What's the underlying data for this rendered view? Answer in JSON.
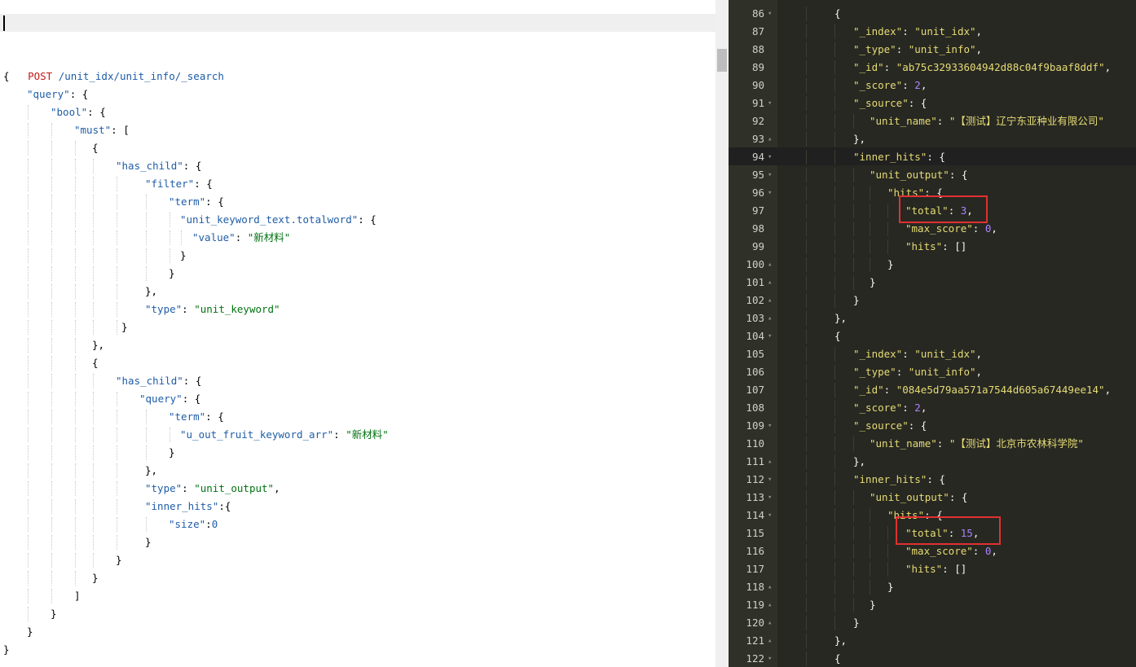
{
  "request": {
    "method": "POST",
    "url": " /unit_idx/unit_info/_search",
    "lines": [
      [
        [
          "p",
          "{"
        ]
      ],
      [
        [
          "k",
          "\"query\""
        ],
        [
          "p",
          ": {"
        ]
      ],
      [
        [
          "k",
          "\"bool\""
        ],
        [
          "p",
          ": {"
        ]
      ],
      [
        [
          "k",
          "\"must\""
        ],
        [
          "p",
          ": ["
        ]
      ],
      [
        [
          "p",
          "{"
        ]
      ],
      [
        [
          "k",
          "\"has_child\""
        ],
        [
          "p",
          ": {"
        ]
      ],
      [
        [
          "k",
          "\"filter\""
        ],
        [
          "p",
          ": {"
        ]
      ],
      [
        [
          "k",
          "\"term\""
        ],
        [
          "p",
          ": {"
        ]
      ],
      [
        [
          "k",
          "\"unit_keyword_text.totalword\""
        ],
        [
          "p",
          ": {"
        ]
      ],
      [
        [
          "k",
          "\"value\""
        ],
        [
          "p",
          ": "
        ],
        [
          "s",
          "\"新材料\""
        ]
      ],
      [
        [
          "p",
          "}"
        ]
      ],
      [
        [
          "p",
          "}"
        ]
      ],
      [
        [
          "p",
          "},"
        ]
      ],
      [
        [
          "k",
          "\"type\""
        ],
        [
          "p",
          ": "
        ],
        [
          "s",
          "\"unit_keyword\""
        ]
      ],
      [
        [
          "p",
          "}"
        ]
      ],
      [
        [
          "p",
          "},"
        ]
      ],
      [
        [
          "p",
          "{"
        ]
      ],
      [
        [
          "k",
          "\"has_child\""
        ],
        [
          "p",
          ": {"
        ]
      ],
      [
        [
          "k",
          "\"query\""
        ],
        [
          "p",
          ": {"
        ]
      ],
      [
        [
          "k",
          "\"term\""
        ],
        [
          "p",
          ": {"
        ]
      ],
      [
        [
          "k",
          "\"u_out_fruit_keyword_arr\""
        ],
        [
          "p",
          ": "
        ],
        [
          "s",
          "\"新材料\""
        ]
      ],
      [
        [
          "p",
          "}"
        ]
      ],
      [
        [
          "p",
          "},"
        ]
      ],
      [
        [
          "k",
          "\"type\""
        ],
        [
          "p",
          ": "
        ],
        [
          "s",
          "\"unit_output\""
        ],
        [
          "p",
          ","
        ]
      ],
      [
        [
          "k",
          "\"inner_hits\""
        ],
        [
          "p",
          ":{"
        ]
      ],
      [
        [
          "k",
          "\"size\""
        ],
        [
          "p",
          ":"
        ],
        [
          "n",
          "0"
        ]
      ],
      [
        [
          "p",
          "}"
        ]
      ],
      [
        [
          "p",
          "}"
        ]
      ],
      [
        [
          "p",
          "}"
        ]
      ],
      [
        [
          "p",
          "]"
        ]
      ],
      [
        [
          "p",
          "}"
        ]
      ],
      [
        [
          "p",
          "}"
        ]
      ],
      [
        [
          "p",
          "}"
        ]
      ]
    ]
  },
  "response": {
    "lines": [
      {
        "n": "86",
        "fold": "▾",
        "t": [
          [
            "w",
            "{"
          ]
        ]
      },
      {
        "n": "87",
        "fold": "",
        "t": [
          [
            "rk",
            "\"_index\""
          ],
          [
            "w",
            ": "
          ],
          [
            "rs",
            "\"unit_idx\""
          ],
          [
            "w",
            ","
          ]
        ]
      },
      {
        "n": "88",
        "fold": "",
        "t": [
          [
            "rk",
            "\"_type\""
          ],
          [
            "w",
            ": "
          ],
          [
            "rs",
            "\"unit_info\""
          ],
          [
            "w",
            ","
          ]
        ]
      },
      {
        "n": "89",
        "fold": "",
        "t": [
          [
            "rk",
            "\"_id\""
          ],
          [
            "w",
            ": "
          ],
          [
            "rs",
            "\"ab75c32933604942d88c04f9baaf8ddf\""
          ],
          [
            "w",
            ","
          ]
        ]
      },
      {
        "n": "90",
        "fold": "",
        "t": [
          [
            "rk",
            "\"_score\""
          ],
          [
            "w",
            ": "
          ],
          [
            "rn",
            "2"
          ],
          [
            "w",
            ","
          ]
        ]
      },
      {
        "n": "91",
        "fold": "▾",
        "t": [
          [
            "rk",
            "\"_source\""
          ],
          [
            "w",
            ": {"
          ]
        ]
      },
      {
        "n": "92",
        "fold": "",
        "t": [
          [
            "rk",
            "\"unit_name\""
          ],
          [
            "w",
            ": "
          ],
          [
            "rs",
            "\"【测试】辽宁东亚种业有限公司\""
          ]
        ]
      },
      {
        "n": "93",
        "fold": "▴",
        "t": [
          [
            "w",
            "},"
          ]
        ]
      },
      {
        "n": "94",
        "fold": "▾",
        "t": [
          [
            "rk",
            "\"inner_hits\""
          ],
          [
            "w",
            ": {"
          ]
        ]
      },
      {
        "n": "95",
        "fold": "▾",
        "t": [
          [
            "rk",
            "\"unit_output\""
          ],
          [
            "w",
            ": {"
          ]
        ]
      },
      {
        "n": "96",
        "fold": "▾",
        "t": [
          [
            "rk",
            "\"hits\""
          ],
          [
            "w",
            ": {"
          ]
        ]
      },
      {
        "n": "97",
        "fold": "",
        "t": [
          [
            "rk",
            "\"total\""
          ],
          [
            "w",
            ": "
          ],
          [
            "rn",
            "3"
          ],
          [
            "w",
            ","
          ]
        ]
      },
      {
        "n": "98",
        "fold": "",
        "t": [
          [
            "rk",
            "\"max_score\""
          ],
          [
            "w",
            ": "
          ],
          [
            "rn",
            "0"
          ],
          [
            "w",
            ","
          ]
        ]
      },
      {
        "n": "99",
        "fold": "",
        "t": [
          [
            "rk",
            "\"hits\""
          ],
          [
            "w",
            ": []"
          ]
        ]
      },
      {
        "n": "100",
        "fold": "▴",
        "t": [
          [
            "w",
            "}"
          ]
        ]
      },
      {
        "n": "101",
        "fold": "▴",
        "t": [
          [
            "w",
            "}"
          ]
        ]
      },
      {
        "n": "102",
        "fold": "▴",
        "t": [
          [
            "w",
            "}"
          ]
        ]
      },
      {
        "n": "103",
        "fold": "▴",
        "t": [
          [
            "w",
            "},"
          ]
        ]
      },
      {
        "n": "104",
        "fold": "▾",
        "t": [
          [
            "w",
            "{"
          ]
        ]
      },
      {
        "n": "105",
        "fold": "",
        "t": [
          [
            "rk",
            "\"_index\""
          ],
          [
            "w",
            ": "
          ],
          [
            "rs",
            "\"unit_idx\""
          ],
          [
            "w",
            ","
          ]
        ]
      },
      {
        "n": "106",
        "fold": "",
        "t": [
          [
            "rk",
            "\"_type\""
          ],
          [
            "w",
            ": "
          ],
          [
            "rs",
            "\"unit_info\""
          ],
          [
            "w",
            ","
          ]
        ]
      },
      {
        "n": "107",
        "fold": "",
        "t": [
          [
            "rk",
            "\"_id\""
          ],
          [
            "w",
            ": "
          ],
          [
            "rs",
            "\"084e5d79aa571a7544d605a67449ee14\""
          ],
          [
            "w",
            ","
          ]
        ]
      },
      {
        "n": "108",
        "fold": "",
        "t": [
          [
            "rk",
            "\"_score\""
          ],
          [
            "w",
            ": "
          ],
          [
            "rn",
            "2"
          ],
          [
            "w",
            ","
          ]
        ]
      },
      {
        "n": "109",
        "fold": "▾",
        "t": [
          [
            "rk",
            "\"_source\""
          ],
          [
            "w",
            ": {"
          ]
        ]
      },
      {
        "n": "110",
        "fold": "",
        "t": [
          [
            "rk",
            "\"unit_name\""
          ],
          [
            "w",
            ": "
          ],
          [
            "rs",
            "\"【测试】北京市农林科学院\""
          ]
        ]
      },
      {
        "n": "111",
        "fold": "▴",
        "t": [
          [
            "w",
            "},"
          ]
        ]
      },
      {
        "n": "112",
        "fold": "▾",
        "t": [
          [
            "rk",
            "\"inner_hits\""
          ],
          [
            "w",
            ": {"
          ]
        ]
      },
      {
        "n": "113",
        "fold": "▾",
        "t": [
          [
            "rk",
            "\"unit_output\""
          ],
          [
            "w",
            ": {"
          ]
        ]
      },
      {
        "n": "114",
        "fold": "▾",
        "t": [
          [
            "rk",
            "\"hits\""
          ],
          [
            "w",
            ": {"
          ]
        ]
      },
      {
        "n": "115",
        "fold": "",
        "t": [
          [
            "rk",
            "\"total\""
          ],
          [
            "w",
            ": "
          ],
          [
            "rn",
            "15"
          ],
          [
            "w",
            ","
          ]
        ]
      },
      {
        "n": "116",
        "fold": "",
        "t": [
          [
            "rk",
            "\"max_score\""
          ],
          [
            "w",
            ": "
          ],
          [
            "rn",
            "0"
          ],
          [
            "w",
            ","
          ]
        ]
      },
      {
        "n": "117",
        "fold": "",
        "t": [
          [
            "rk",
            "\"hits\""
          ],
          [
            "w",
            ": []"
          ]
        ]
      },
      {
        "n": "118",
        "fold": "▴",
        "t": [
          [
            "w",
            "}"
          ]
        ]
      },
      {
        "n": "119",
        "fold": "▴",
        "t": [
          [
            "w",
            "}"
          ]
        ]
      },
      {
        "n": "120",
        "fold": "▴",
        "t": [
          [
            "w",
            "}"
          ]
        ]
      },
      {
        "n": "121",
        "fold": "▴",
        "t": [
          [
            "w",
            "},"
          ]
        ]
      },
      {
        "n": "122",
        "fold": "▾",
        "t": [
          [
            "w",
            "{"
          ]
        ]
      }
    ]
  },
  "colors": {
    "request_key": "#1f5da8",
    "request_string": "#007311",
    "method": "#c41a16",
    "response_bg": "#272822",
    "response_key": "#e6db74",
    "response_number": "#ae81ff",
    "highlight_box": "#e03131"
  }
}
